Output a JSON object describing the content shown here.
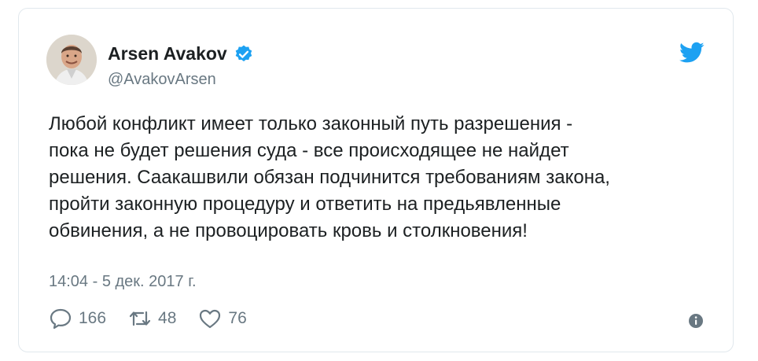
{
  "tweet": {
    "author_name": "Arsen Avakov",
    "handle": "@AvakovArsen",
    "text": "Любой конфликт имеет только законный путь разрешения -\nпока не будет решения суда - все происходящее не найдет\nрешения. Саакашвили обязан подчинится требованиям закона,\nпройти законную процедуру и ответить на предьявленные\nобвинения, а не провоцировать кровь и столкновения!",
    "timestamp": "14:04 - 5 дек. 2017 г.",
    "replies": "166",
    "retweets": "48",
    "likes": "76"
  },
  "icons": {
    "verified": "verified-badge-icon",
    "brand": "twitter-bird-icon",
    "reply": "reply-icon",
    "retweet": "retweet-icon",
    "like": "heart-icon",
    "info": "info-icon"
  },
  "colors": {
    "twitter_blue": "#1da1f2",
    "text": "#1c2022",
    "muted": "#697882",
    "border": "#e1e8ed"
  }
}
